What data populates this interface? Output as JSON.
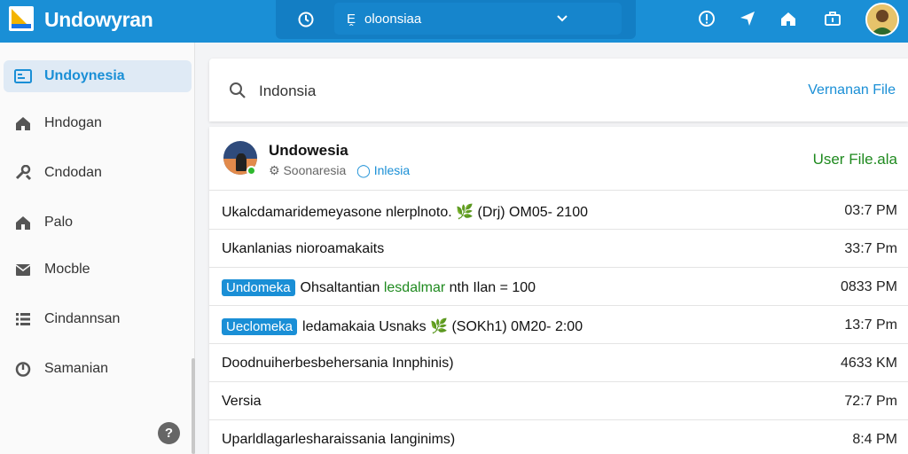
{
  "app": {
    "title": "Undowyran"
  },
  "search": {
    "text": "oloonsiaa",
    "icon": "person-icon"
  },
  "sidebar": {
    "items": [
      {
        "label": "Undoynesia",
        "icon": "inbox-icon",
        "active": true
      },
      {
        "label": "Hndogan",
        "icon": "home-icon"
      },
      {
        "label": "Cndodan",
        "icon": "tools-icon"
      },
      {
        "label": "Palo",
        "icon": "house-icon"
      },
      {
        "label": "Mocble",
        "icon": "mail-icon"
      },
      {
        "label": "Cindannsan",
        "icon": "list-icon"
      },
      {
        "label": "Samanian",
        "icon": "power-icon"
      }
    ],
    "help": "?"
  },
  "main": {
    "query": "Indonsia",
    "query_action": "Vernanan File",
    "user": {
      "name": "Undowesia",
      "handle": "Soonaresia",
      "location": "Inlesia",
      "action": "User File.ala"
    },
    "rows": [
      {
        "text": "Ukalcdamaridemeyasone nlerplnoto. 🌿 (Drj) OM05- 2100",
        "time": "03:7 PM"
      },
      {
        "text": "Ukanlanias nioroamakaits",
        "time": "33:7 Pm"
      },
      {
        "tag": "Undomeka",
        "text": "Ohsaltantian",
        "green": "lesdalmar",
        "rest": "nth Ilan = 100",
        "time": "0833 PM"
      },
      {
        "tag": "Ueclomeka",
        "text": "ledamakaia Usnaks 🌿 (SOKh1) 0M20- 2:00",
        "time": "13:7 Pm"
      },
      {
        "text": "Doodnuiherbesbehersania Innphinis)",
        "time": "4633 KM"
      },
      {
        "text": "Versia",
        "time": "72:7 Pm"
      },
      {
        "text": "Uparldlagarlesharaissania Ianginims)",
        "time": "8:4 PM"
      }
    ]
  },
  "colors": {
    "brand": "#1a8fd6",
    "accent_green": "#1f8a1f"
  }
}
